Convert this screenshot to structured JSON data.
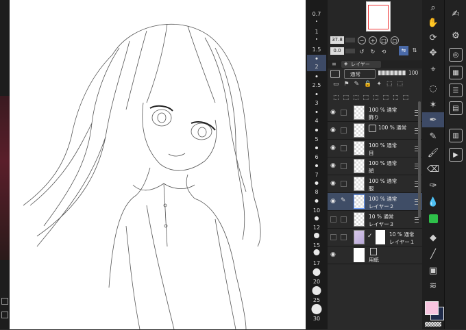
{
  "brush_sizes": [
    "0.7",
    "1",
    "1.5",
    "2",
    "2.5",
    "3",
    "4",
    "5",
    "6",
    "7",
    "8",
    "10",
    "12",
    "15",
    "17",
    "20",
    "25",
    "30"
  ],
  "brush_selected": "2",
  "navigator": {
    "zoom": "37.8",
    "rotation": "0.0"
  },
  "layer_panel": {
    "tab_label": "レイヤー",
    "blend_mode": "通常",
    "opacity": "100",
    "layers": [
      {
        "blend": "100 % 通常",
        "name": "飾り",
        "visible": true,
        "selected": false
      },
      {
        "blend": "100 % 通常",
        "name": "",
        "visible": true,
        "selected": false
      },
      {
        "blend": "100 % 通常",
        "name": "目",
        "visible": true,
        "selected": false
      },
      {
        "blend": "100 % 通常",
        "name": "顔",
        "visible": true,
        "selected": false
      },
      {
        "blend": "100 % 通常",
        "name": "服",
        "visible": true,
        "selected": false
      },
      {
        "blend": "100 % 通常",
        "name": "レイヤー２",
        "visible": true,
        "selected": true
      },
      {
        "blend": "10 % 通常",
        "name": "レイヤー３",
        "visible": false,
        "selected": false
      },
      {
        "blend": "10 % 通常",
        "name": "レイヤー１",
        "visible": false,
        "selected": false
      },
      {
        "blend": "",
        "name": "用紙",
        "visible": true,
        "selected": false
      }
    ]
  },
  "colors": {
    "main_color": "#f7c5df",
    "sub_color": "#1f2b4a",
    "selection": "#3f4d66"
  },
  "tools": [
    "zoom-icon",
    "hand-icon",
    "rotate-icon",
    "move-icon",
    "eyedropper-icon",
    "lasso-icon",
    "wand-icon",
    "pen-icon",
    "pencil-icon",
    "brush-icon",
    "eraser-icon",
    "ink-icon",
    "blend-icon",
    "fill-icon",
    "shape-icon",
    "line-icon",
    "gradient-icon",
    "text-icon"
  ]
}
